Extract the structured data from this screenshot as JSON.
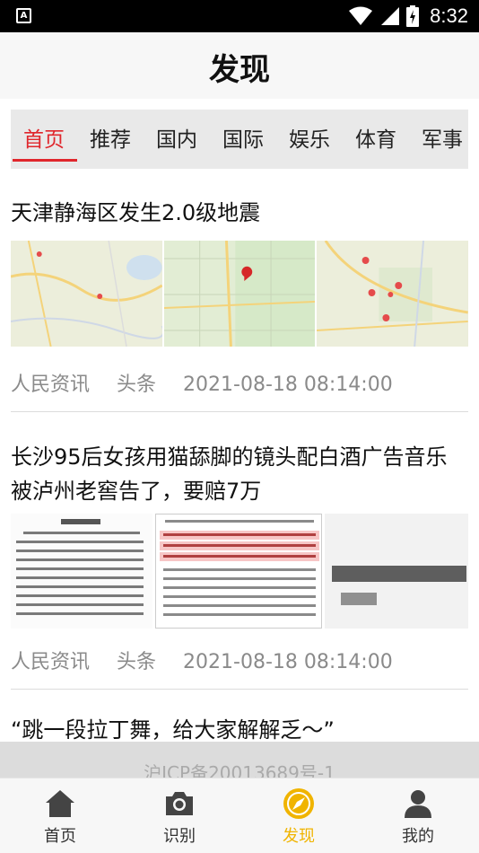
{
  "status_bar": {
    "time": "8:32",
    "app_badge": "A"
  },
  "header": {
    "title": "发现"
  },
  "tabs": [
    {
      "label": "首页",
      "active": true
    },
    {
      "label": "推荐"
    },
    {
      "label": "国内"
    },
    {
      "label": "国际"
    },
    {
      "label": "娱乐"
    },
    {
      "label": "体育"
    },
    {
      "label": "军事"
    }
  ],
  "news": [
    {
      "title": "天津静海区发生2.0级地震",
      "source": "人民资讯",
      "tag": "头条",
      "time": "2021-08-18 08:14:00"
    },
    {
      "title": "长沙95后女孩用猫舔脚的镜头配白酒广告音乐被泸州老窖告了，要赔7万",
      "source": "人民资讯",
      "tag": "头条",
      "time": "2021-08-18 08:14:00"
    },
    {
      "title": "“跳一段拉丁舞，给大家解解乏～”"
    }
  ],
  "footer": {
    "icp": "沪ICP备20013689号-1"
  },
  "bottom_nav": [
    {
      "label": "首页",
      "icon": "home-icon"
    },
    {
      "label": "识别",
      "icon": "camera-icon"
    },
    {
      "label": "发现",
      "icon": "compass-icon",
      "active": true
    },
    {
      "label": "我的",
      "icon": "user-icon"
    }
  ],
  "colors": {
    "accent_red": "#e0262c",
    "active_yellow": "#f0b400"
  }
}
